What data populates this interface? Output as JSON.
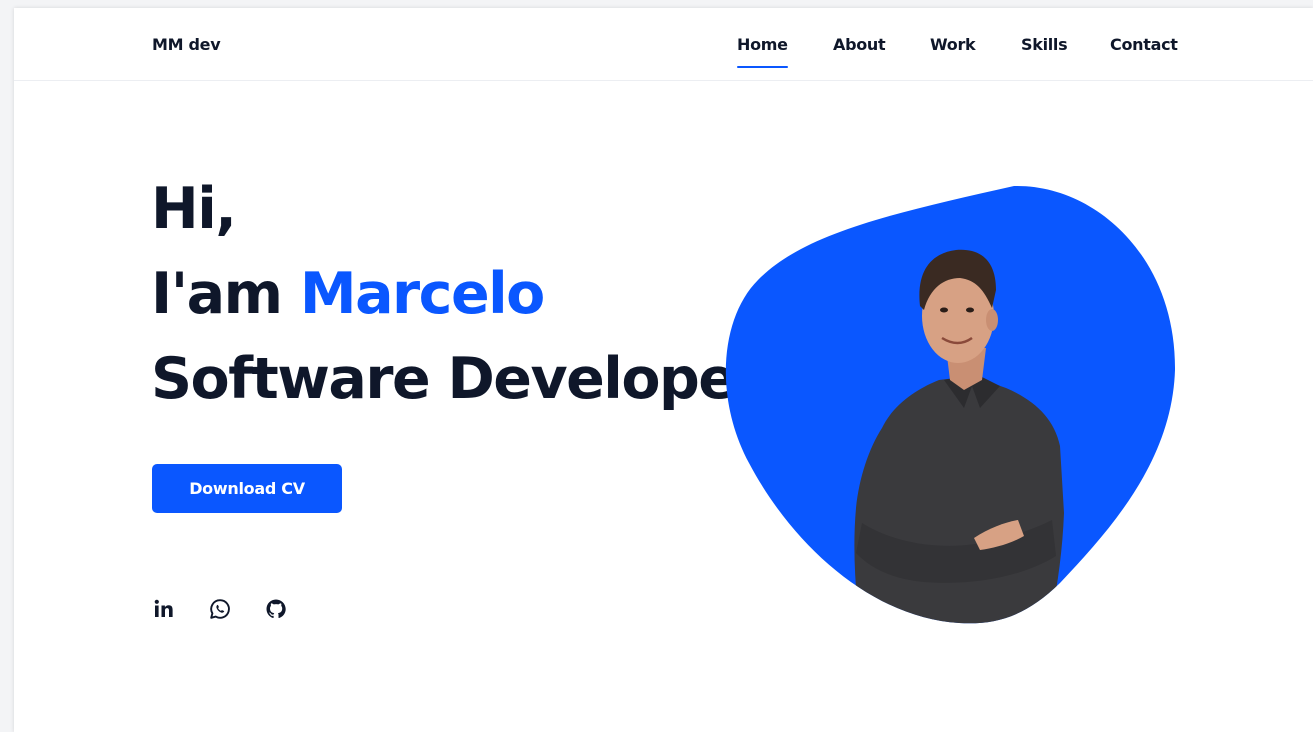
{
  "header": {
    "logo": "MM dev",
    "nav": [
      {
        "label": "Home",
        "active": true
      },
      {
        "label": "About",
        "active": false
      },
      {
        "label": "Work",
        "active": false
      },
      {
        "label": "Skills",
        "active": false
      },
      {
        "label": "Contact",
        "active": false
      }
    ]
  },
  "hero": {
    "greeting": "Hi,",
    "intro_prefix": "I'am ",
    "name": "Marcelo",
    "role": "Software Developer",
    "cta_label": "Download CV"
  },
  "social": [
    {
      "icon": "linkedin-icon"
    },
    {
      "icon": "whatsapp-icon"
    },
    {
      "icon": "github-icon"
    }
  ],
  "colors": {
    "accent": "#0a57ff",
    "text": "#0f172a",
    "background": "#ffffff",
    "shirt": "#3a3a3d",
    "skin": "#d7a184"
  }
}
